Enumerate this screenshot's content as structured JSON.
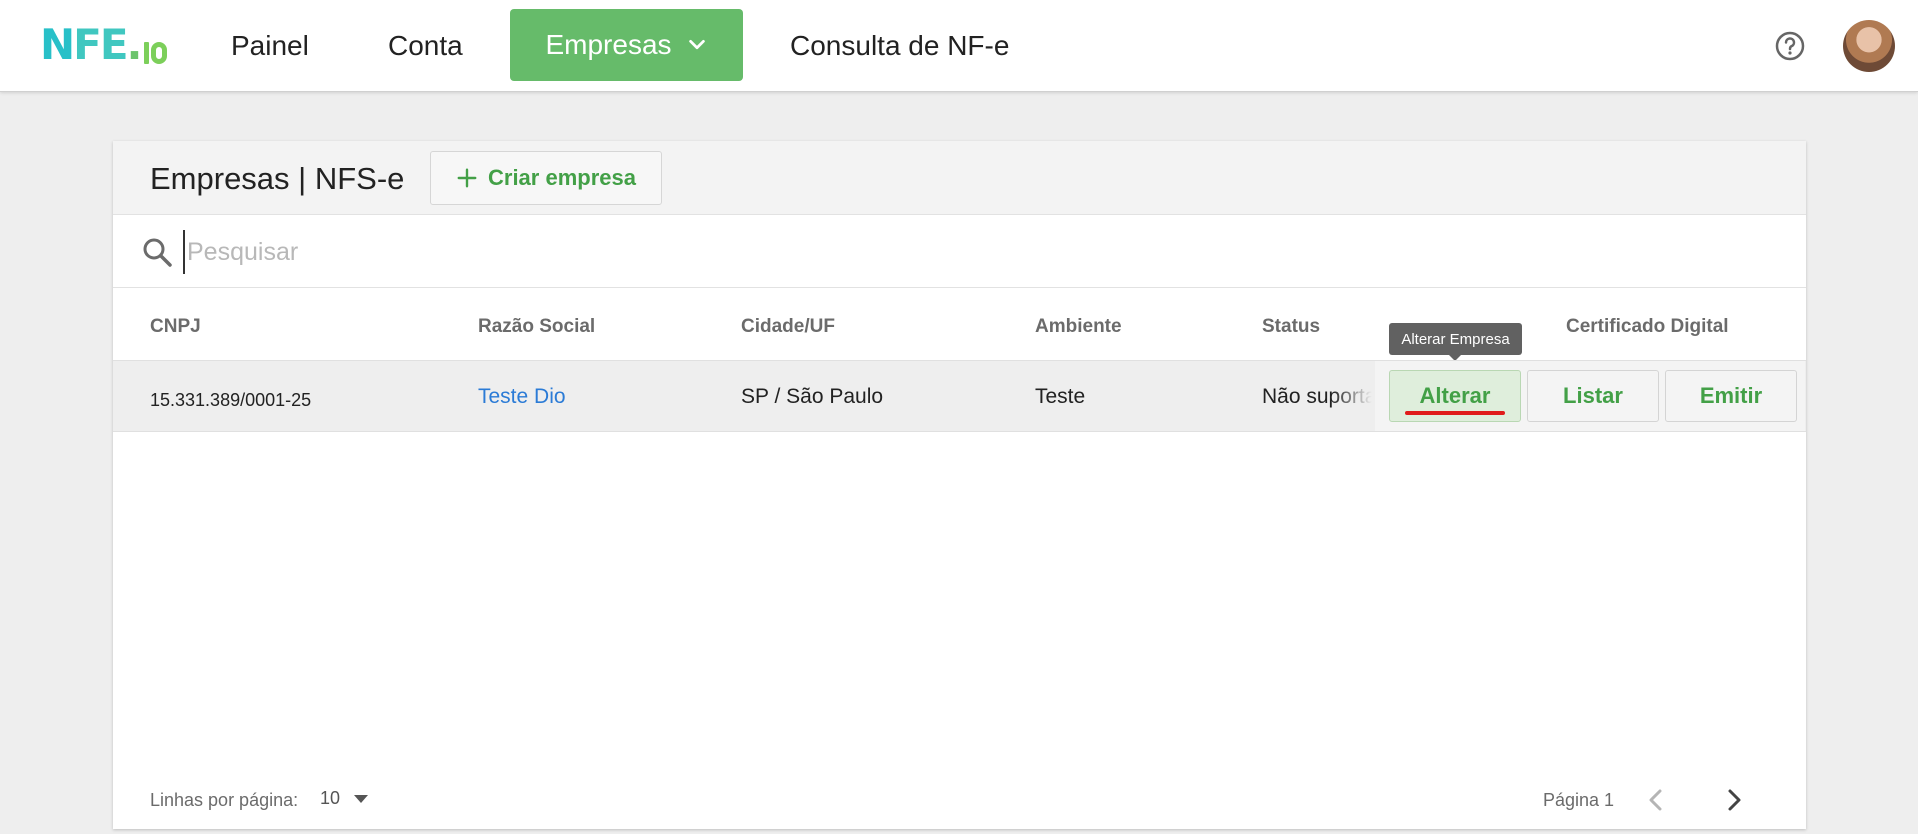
{
  "brand": {
    "logo_letters": "NFE",
    "logo_suffix": "io"
  },
  "nav": {
    "painel": "Painel",
    "conta": "Conta",
    "empresas": "Empresas",
    "consulta": "Consulta de NF-e"
  },
  "icons": {
    "help": "help-circle-icon",
    "avatar": "user-avatar",
    "search": "search-icon",
    "add": "plus-icon",
    "dropdown": "chevron-down-icon"
  },
  "colors": {
    "accent": "#66bb6a",
    "accent_text": "#43a047",
    "link": "#2b7bd6",
    "highlight": "#e01b1b"
  },
  "page": {
    "title": "Empresas | NFS-e",
    "create_button": "Criar empresa"
  },
  "search": {
    "placeholder": "Pesquisar",
    "value": ""
  },
  "table": {
    "headers": {
      "cnpj": "CNPJ",
      "razao_social": "Razão Social",
      "cidade_uf": "Cidade/UF",
      "ambiente": "Ambiente",
      "status": "Status",
      "certificado": "Certificado Digital"
    },
    "rows": [
      {
        "cnpj": "15.331.389/0001-25",
        "razao_social": "Teste Dio",
        "cidade_uf": "SP / São Paulo",
        "ambiente": "Teste",
        "status": "Não suportado",
        "actions": {
          "alterar": "Alterar",
          "listar": "Listar",
          "emitir": "Emitir"
        }
      }
    ]
  },
  "tooltip": "Alterar Empresa",
  "pagination": {
    "rows_per_page_label": "Linhas por página:",
    "rows_per_page_value": "10",
    "page_label": "Página 1"
  }
}
